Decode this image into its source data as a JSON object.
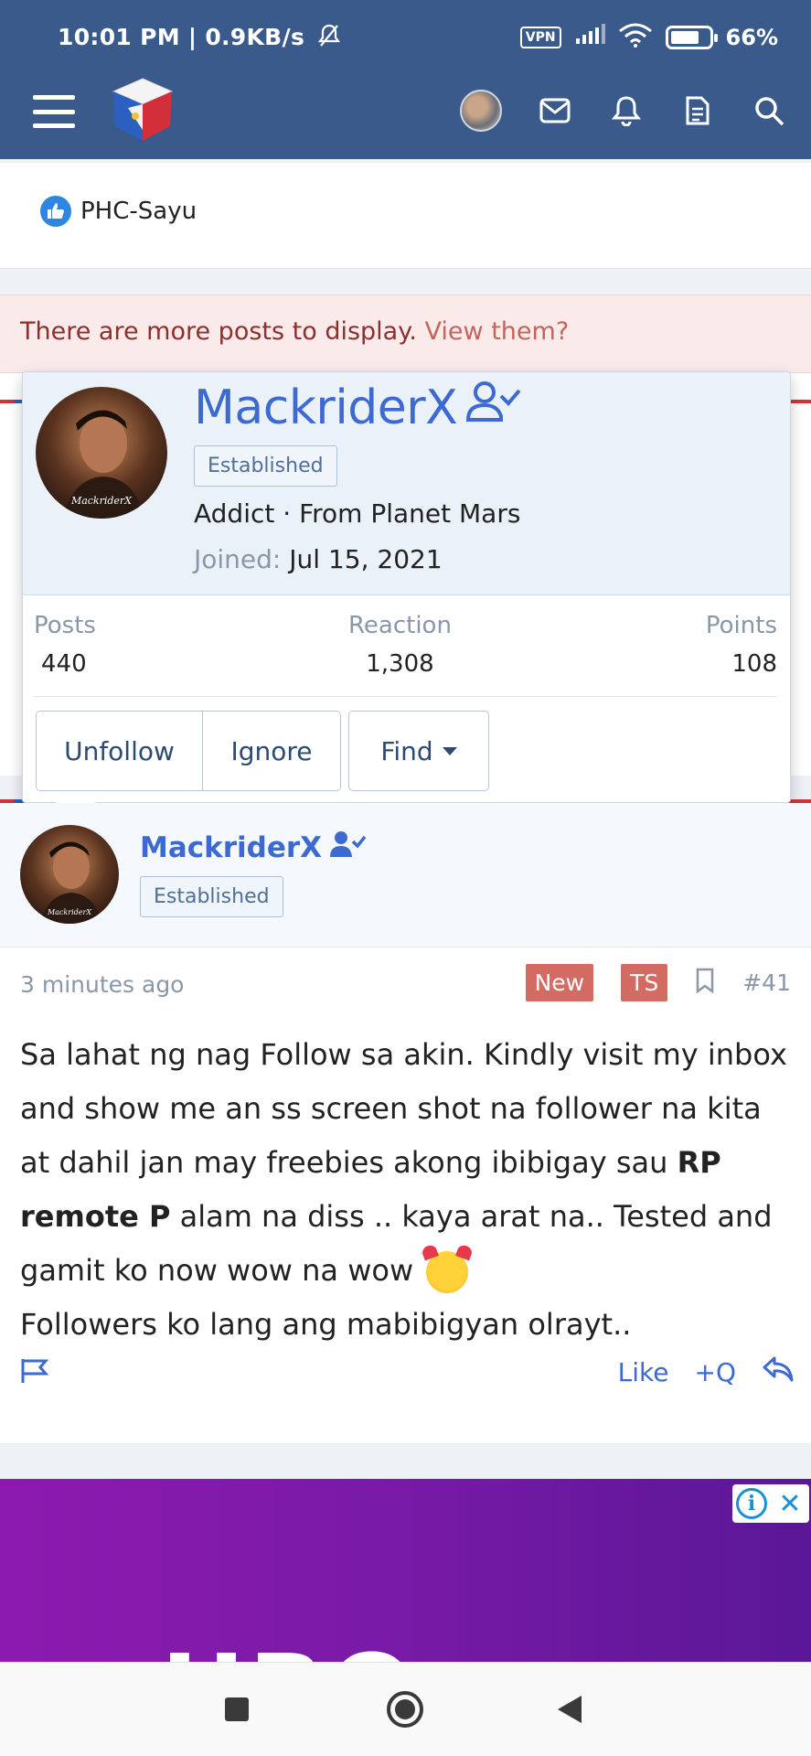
{
  "status_bar": {
    "time": "10:01 PM | 0.9KB/s",
    "vpn": "VPN",
    "battery": "66%",
    "battery_level": 0.66
  },
  "header": {
    "icons": [
      "menu-icon",
      "site-logo",
      "user-avatar",
      "inbox-icon",
      "alerts-bell-icon",
      "whats-new-icon",
      "search-icon"
    ]
  },
  "reaction": {
    "user": "PHC-Sayu",
    "icon": "like-icon"
  },
  "notice": {
    "text": "There are more posts to display.",
    "link": "View them?"
  },
  "member_popup": {
    "username": "MackriderX",
    "avatar_caption": "MackriderX",
    "badge": "Established",
    "title_line": "Addict · From Planet Mars",
    "joined_label": "Joined:",
    "joined_date": "Jul 15, 2021",
    "stats": {
      "posts_label": "Posts",
      "posts_value": "440",
      "reaction_label": "Reaction",
      "reaction_value": "1,308",
      "points_label": "Points",
      "points_value": "108"
    },
    "buttons": {
      "unfollow": "Unfollow",
      "ignore": "Ignore",
      "find": "Find"
    }
  },
  "post": {
    "username": "MackriderX",
    "avatar_caption": "MackriderX",
    "badge": "Established",
    "time": "3 minutes ago",
    "tag_new": "New",
    "tag_ts": "TS",
    "post_number": "#41",
    "body": {
      "line1": "Sa lahat ng nag Follow sa akin. Kindly visit my inbox and show me an ss screen shot na follower na kita at dahil jan may freebies akong ibibigay sau ",
      "bold": "RP remote P",
      "line2": " alam na diss .. kaya arat na.. Tested and gamit ko now wow na wow",
      "line3": "Followers ko lang ang mabibigyan olrayt.."
    },
    "actions": {
      "like": "Like",
      "quote": "+Q"
    }
  },
  "ad": {
    "info": "i",
    "close": "✕",
    "brand": "HBO max"
  },
  "colors": {
    "header_bg": "#3b5a8c",
    "link_blue": "#3d6ad0",
    "notice_bg": "#fbeaea",
    "tag_red": "#d46b62",
    "ad_purple": "#7a1aa8"
  }
}
